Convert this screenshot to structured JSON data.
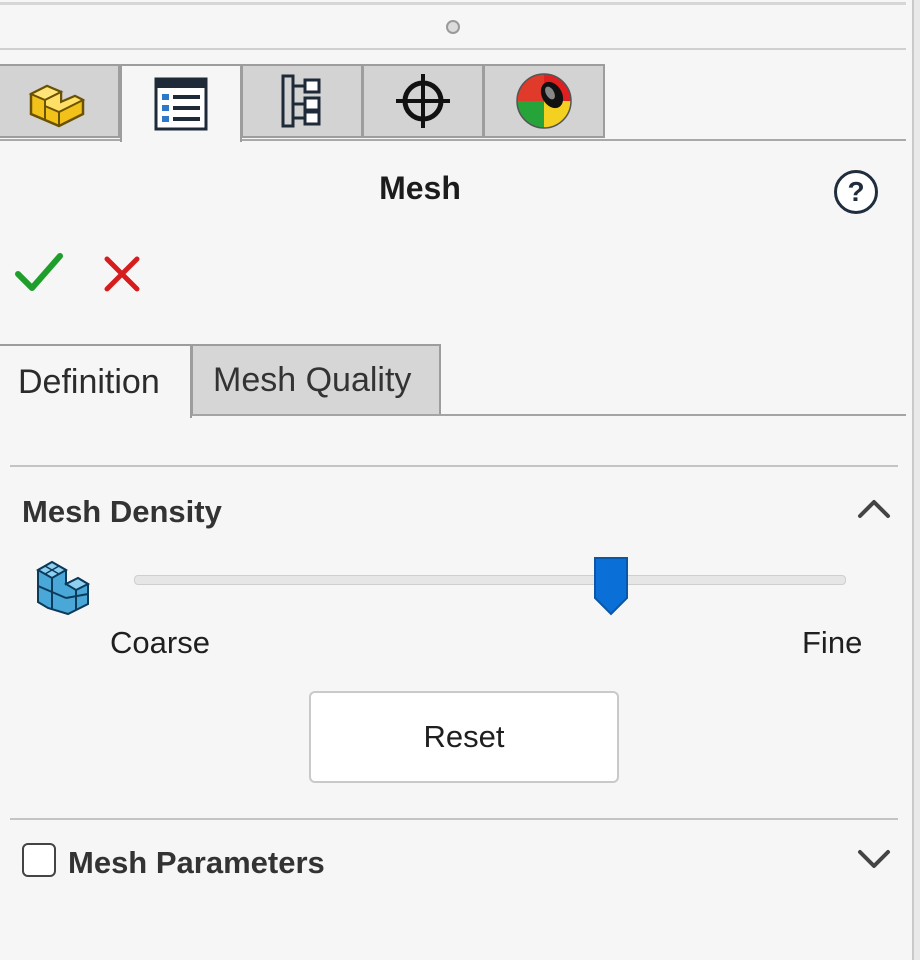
{
  "manager_tabs": [
    {
      "id": "feature-manager",
      "icon": "part-icon",
      "active": false
    },
    {
      "id": "property-manager",
      "icon": "property-list-icon",
      "active": true
    },
    {
      "id": "configuration-manager",
      "icon": "configuration-tree-icon",
      "active": false
    },
    {
      "id": "dimxpert-manager",
      "icon": "crosshair-icon",
      "active": false
    },
    {
      "id": "display-manager",
      "icon": "appearance-ball-icon",
      "active": false
    }
  ],
  "header": {
    "title": "Mesh",
    "help_symbol": "?"
  },
  "actions": {
    "ok_icon": "checkmark-icon",
    "cancel_icon": "x-icon"
  },
  "sub_tabs": [
    {
      "label": "Definition",
      "active": true
    },
    {
      "label": "Mesh Quality",
      "active": false
    }
  ],
  "mesh_density": {
    "title": "Mesh Density",
    "slider_value": 0.67,
    "min_label": "Coarse",
    "max_label": "Fine",
    "reset_label": "Reset",
    "expanded": true
  },
  "mesh_parameters": {
    "title": "Mesh Parameters",
    "checked": false,
    "expanded": false
  },
  "colors": {
    "accent": "#0a6fd6",
    "ok_green": "#1f9e2c",
    "cancel_red": "#d51d1d"
  }
}
